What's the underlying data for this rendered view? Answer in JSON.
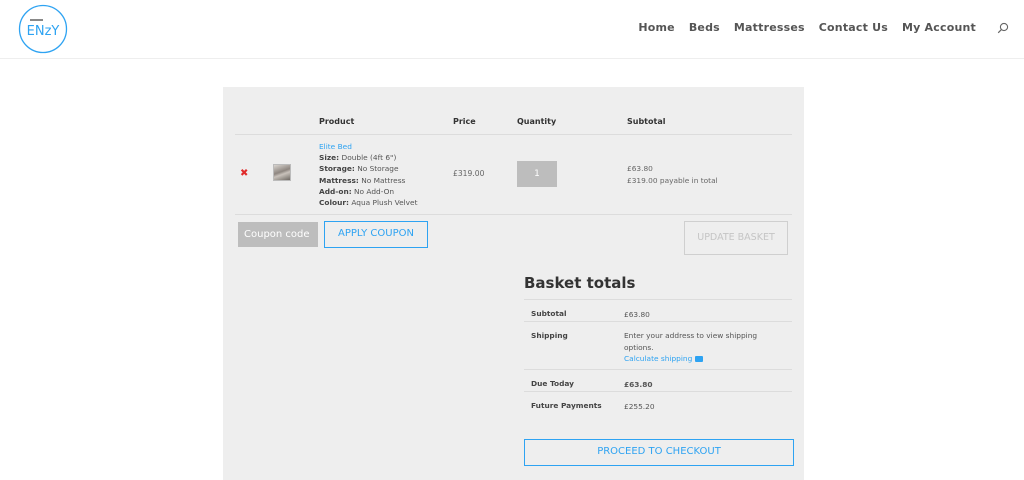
{
  "brand": {
    "logo_text": "ENzY",
    "accent": "#2ea3f2",
    "remove_color": "#e02b2b"
  },
  "nav": {
    "items": [
      "Home",
      "Beds",
      "Mattresses",
      "Contact Us",
      "My Account"
    ],
    "search_icon": "search-icon"
  },
  "cart": {
    "headers": {
      "product": "Product",
      "price": "Price",
      "quantity": "Quantity",
      "subtotal": "Subtotal"
    },
    "item": {
      "remove_glyph": "✖",
      "name": "Elite Bed",
      "attributes": [
        {
          "label": "Size:",
          "value": "Double (4ft 6\")"
        },
        {
          "label": "Storage:",
          "value": "No Storage"
        },
        {
          "label": "Mattress:",
          "value": "No Mattress"
        },
        {
          "label": "Add-on:",
          "value": "No Add-On"
        },
        {
          "label": "Colour:",
          "value": "Aqua Plush Velvet"
        }
      ],
      "price": "£319.00",
      "quantity": "1",
      "subtotal": "£63.80",
      "subtotal_note": "£319.00 payable in total"
    },
    "coupon_placeholder": "Coupon code",
    "apply_label": "APPLY COUPON",
    "update_label": "UPDATE BASKET"
  },
  "totals": {
    "title": "Basket totals",
    "subtotal_label": "Subtotal",
    "subtotal_value": "£63.80",
    "shipping_label": "Shipping",
    "shipping_text": "Enter your address to view shipping options.",
    "shipping_link": "Calculate shipping",
    "due_label": "Due Today",
    "due_value": "£63.80",
    "future_label": "Future Payments",
    "future_value": "£255.20",
    "checkout_label": "PROCEED TO CHECKOUT"
  }
}
